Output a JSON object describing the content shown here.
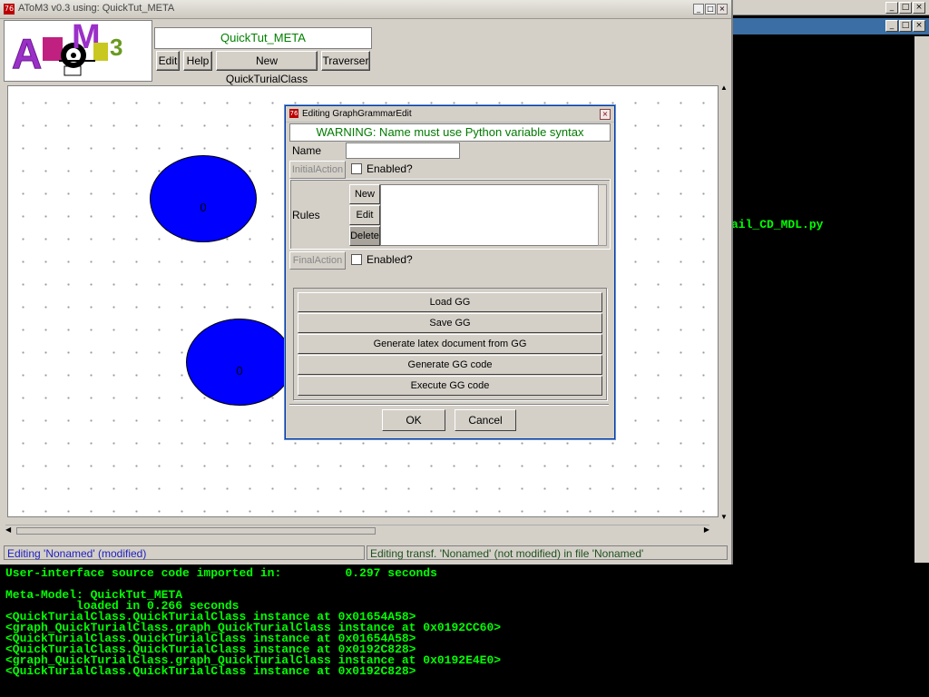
{
  "main_window": {
    "title": "AToM3 v0.3 using: QuickTut_META",
    "meta_model_name": "QuickTut_META",
    "buttons": [
      "Edit",
      "Help",
      "New QuickTurialClass",
      "Traverser"
    ],
    "ellipse_labels": [
      "0",
      "0"
    ],
    "status_left": "Editing 'Nonamed' (modified)",
    "status_right": "Editing transf. 'Nonamed' (not modified) in file 'Nonamed'"
  },
  "logo": {
    "text": "AToM3"
  },
  "dialog": {
    "title": "Editing GraphGrammarEdit",
    "warning": "WARNING: Name must use Python variable syntax",
    "name_label": "Name",
    "name_value": "",
    "initial_action_label": "InitialAction",
    "enabled_label": "Enabled?",
    "rules_label": "Rules",
    "rules_buttons": {
      "new": "New",
      "edit": "Edit",
      "delete": "Delete"
    },
    "final_action_label": "FinalAction",
    "gg_buttons": [
      "Load GG",
      "Save GG",
      "Generate latex document from GG",
      "Generate GG code",
      "Execute GG code"
    ],
    "ok_label": "OK",
    "cancel_label": "Cancel"
  },
  "console": {
    "side_file": "ail_CD_MDL.py",
    "lines": [
      "User-interface source code imported in:         0.297 seconds",
      "",
      "Meta-Model: QuickTut_META",
      "          loaded in 0.266 seconds",
      "<QuickTurialClass.QuickTurialClass instance at 0x01654A58>",
      "<graph_QuickTurialClass.graph_QuickTurialClass instance at 0x0192CC60>",
      "<QuickTurialClass.QuickTurialClass instance at 0x01654A58>",
      "<QuickTurialClass.QuickTurialClass instance at 0x0192C828>",
      "<graph_QuickTurialClass.graph_QuickTurialClass instance at 0x0192E4E0>",
      "<QuickTurialClass.QuickTurialClass instance at 0x0192C828>"
    ]
  },
  "colors": {
    "console_text": "#00ff00",
    "ellipse_fill": "#0000ff",
    "warning_text": "#007a00"
  }
}
